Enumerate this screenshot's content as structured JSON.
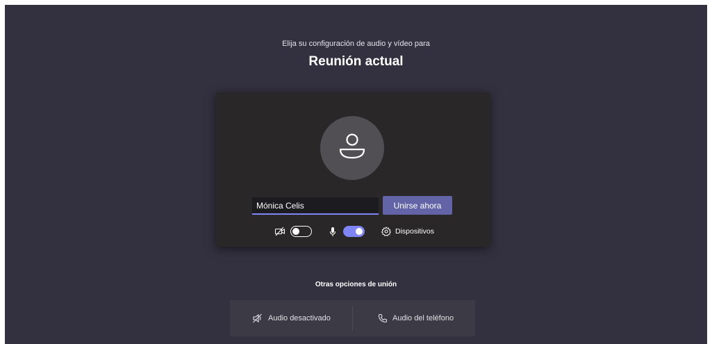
{
  "header": {
    "subtitle": "Elija su configuración de audio y vídeo para",
    "title": "Reunión actual"
  },
  "preview": {
    "avatar_icon": "person-icon",
    "name_value": "Mónica Celis",
    "join_label": "Unirse ahora",
    "camera_icon": "camera-off-icon",
    "camera_on": false,
    "mic_icon": "microphone-icon",
    "mic_on": true,
    "devices_icon": "gear-icon",
    "devices_label": "Dispositivos"
  },
  "other_options": {
    "title": "Otras opciones de unión",
    "audio_off_icon": "speaker-off-icon",
    "audio_off_label": "Audio desactivado",
    "phone_icon": "phone-icon",
    "phone_label": "Audio del teléfono"
  },
  "colors": {
    "background": "#33313f",
    "panel": "#292728",
    "accent": "#6264a7",
    "toggle_on": "#7f85f5"
  }
}
